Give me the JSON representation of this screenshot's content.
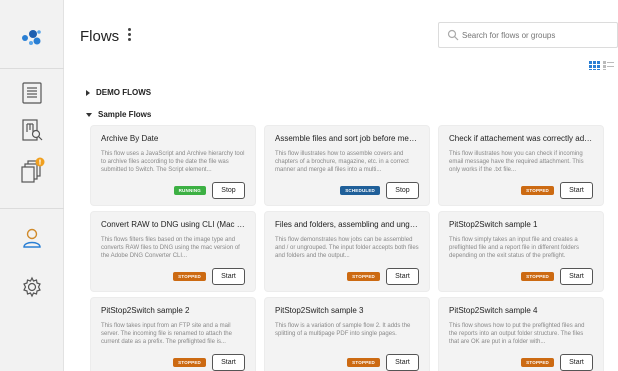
{
  "header": {
    "title": "Flows",
    "search_placeholder": "Search for flows or groups"
  },
  "sidebar": {
    "items": [
      {
        "name": "logo",
        "icon": "logo-icon"
      },
      {
        "name": "flows",
        "icon": "list-icon"
      },
      {
        "name": "reports",
        "icon": "report-search-icon"
      },
      {
        "name": "jobs",
        "icon": "stacked-documents-icon",
        "alert": true
      },
      {
        "name": "users",
        "icon": "user-icon"
      },
      {
        "name": "settings",
        "icon": "gear-icon"
      }
    ]
  },
  "colors": {
    "running": "#3cb043",
    "scheduled": "#1f5f99",
    "stopped": "#cc6a12",
    "accent": "#2a7fd4",
    "alert": "#f0a020"
  },
  "groups": [
    {
      "label": "DEMO FLOWS",
      "expanded": false
    },
    {
      "label": "Sample Flows",
      "expanded": true
    }
  ],
  "cards": [
    {
      "title": "Archive By Date",
      "desc": "This flow uses a JavaScript and Archive hierarchy tool to archive files according to the date the file was submitted to Switch. The Script element...",
      "status": "RUNNING",
      "status_key": "running",
      "action": "Stop"
    },
    {
      "title": "Assemble files and sort job before mergin...",
      "desc": "This flow illustrates how to assemble covers and chapters of a brochure, magazine, etc. in a correct manner and merge all files into a multi...",
      "status": "SCHEDULED",
      "status_key": "scheduled",
      "action": "Stop"
    },
    {
      "title": "Check if attachement was correctly added",
      "desc": "This flow illustrates how you can check if incoming email message have the required attachment. This only works if the .txt file...",
      "status": "STOPPED",
      "status_key": "stopped",
      "action": "Start"
    },
    {
      "title": "Convert RAW to DNG using CLI (Mac only)",
      "desc": "This flows filters files based on the image type and converts RAW files to DNG using the mac version of the Adobe DNG Converter CLI...",
      "status": "STOPPED",
      "status_key": "stopped",
      "action": "Start"
    },
    {
      "title": "Files and folders, assembling and ungroup...",
      "desc": "This flow demonstrates how jobs can be assembled and / or ungrouped. The input folder accepts both files and folders and the output...",
      "status": "STOPPED",
      "status_key": "stopped",
      "action": "Start"
    },
    {
      "title": "PitStop2Switch sample 1",
      "desc": "This flow simply takes an input file and creates a preflighted file and a report file in different folders depending on the exit status of the preflight.",
      "status": "STOPPED",
      "status_key": "stopped",
      "action": "Start"
    },
    {
      "title": "PitStop2Switch sample 2",
      "desc": "This flow takes input from an FTP site and a mail server. The incoming file is renamed to attach the current date as a prefix. The preflighted file is...",
      "status": "STOPPED",
      "status_key": "stopped",
      "action": "Start"
    },
    {
      "title": "PitStop2Switch sample 3",
      "desc": "This flow is a variation of sample flow 2. It adds the splitting of a multipage PDF into single pages.",
      "status": "STOPPED",
      "status_key": "stopped",
      "action": "Start"
    },
    {
      "title": "PitStop2Switch sample 4",
      "desc": "This flow shows how to put the preflighted files and the reports into an output folder structure. The files that are OK are put in a folder with...",
      "status": "STOPPED",
      "status_key": "stopped",
      "action": "Start"
    }
  ]
}
